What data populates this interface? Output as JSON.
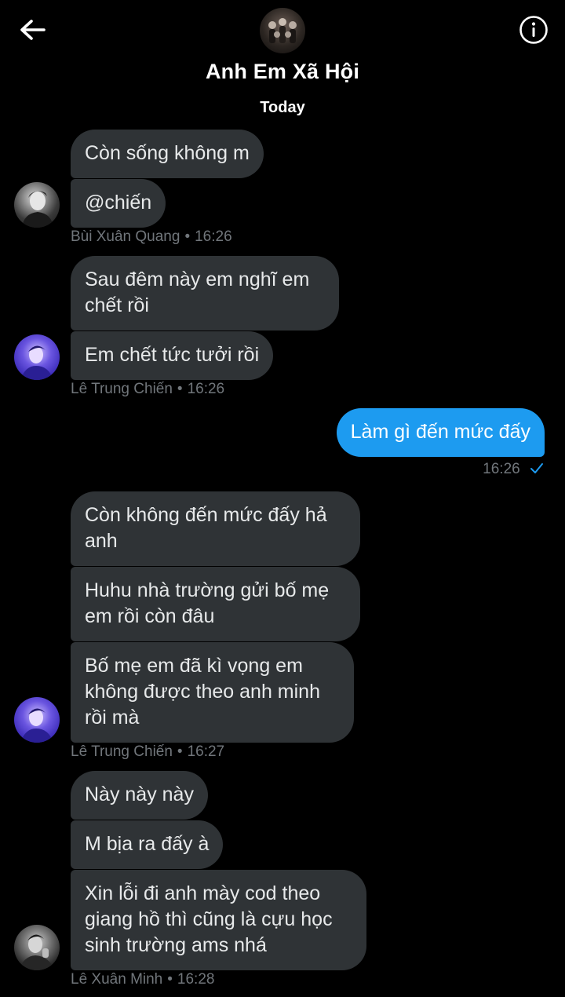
{
  "header": {
    "group_name": "Anh Em Xã Hội",
    "day_label": "Today",
    "back_icon": "arrow-left-icon",
    "info_icon": "info-icon"
  },
  "messages": [
    {
      "sender": "Bùi Xuân Quang",
      "time": "16:26",
      "bubbles": [
        "Còn sống không m",
        "@chiến"
      ]
    },
    {
      "sender": "Lê Trung Chiến",
      "time": "16:26",
      "bubbles": [
        "Sau đêm này em nghĩ em chết rồi",
        "Em chết tức tưởi rồi"
      ]
    },
    {
      "sender": "me",
      "time": "16:26",
      "bubbles": [
        "Làm gì đến mức đấy"
      ],
      "status": "sent-check-icon"
    },
    {
      "sender": "Lê Trung Chiến",
      "time": "16:27",
      "bubbles": [
        "Còn không đến mức đấy hả anh",
        "Huhu nhà trường gửi bố mẹ em rồi còn đâu",
        "Bố mẹ em đã kì vọng em không được theo anh minh rồi mà"
      ]
    },
    {
      "sender": "Lê Xuân Minh",
      "time": "16:28",
      "bubbles": [
        "Này này này",
        "M bịa ra đấy à",
        "Xin lỗi đi anh mày cod theo giang hồ thì cũng là cựu học sinh trường ams nhá"
      ]
    }
  ],
  "colors": {
    "incoming_bubble": "#2f3336",
    "outgoing_bubble": "#1d9bf0",
    "meta_text": "#71767b",
    "background": "#000000"
  }
}
